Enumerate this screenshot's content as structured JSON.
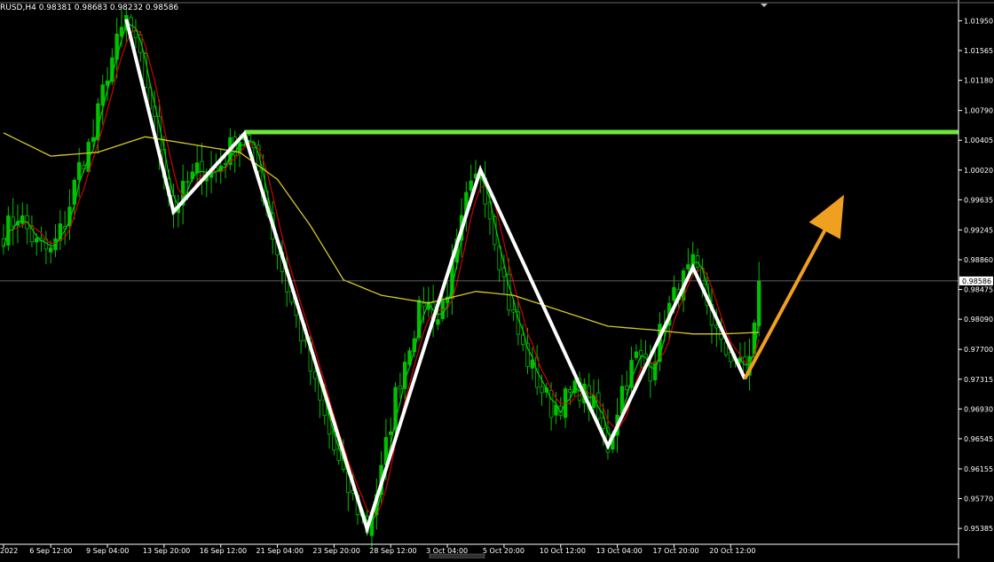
{
  "header": {
    "symbol_info": "RUSD,H4  0.98381 0.98683 0.98232 0.98586"
  },
  "colors": {
    "background": "#000000",
    "frame": "#ffffff",
    "bull_candle": "#00c000",
    "bear_candle": "#000000",
    "wick": "#00c000",
    "ma_fast": "#d40000",
    "ma_mid": "#00d000",
    "ma_slow": "#d8c828",
    "resistance": "#6ee63c",
    "pattern_lines": "#ffffff",
    "forecast_arrow": "#f0a020",
    "bid_line": "#808080",
    "current_price_tag_bg": "#ffffff",
    "current_price_tag_text": "#000000"
  },
  "chart_data": {
    "type": "candlestick",
    "ylim": [
      0.9518,
      1.0215
    ],
    "price_axis_ticks": [
      "1.01950",
      "1.01565",
      "1.01180",
      "1.00790",
      "1.00405",
      "1.00020",
      "0.99635",
      "0.99245",
      "0.98860",
      "0.98475",
      "0.98090",
      "0.97700",
      "0.97315",
      "0.96930",
      "0.96545",
      "0.96155",
      "0.95770",
      "0.95385"
    ],
    "time_axis_ticks": [
      {
        "label": "2022",
        "i": 0
      },
      {
        "label": "6 Sep 12:00",
        "i": 10
      },
      {
        "label": "9 Sep 04:00",
        "i": 22
      },
      {
        "label": "13 Sep 20:00",
        "i": 34
      },
      {
        "label": "16 Sep 12:00",
        "i": 46
      },
      {
        "label": "21 Sep 04:00",
        "i": 58
      },
      {
        "label": "23 Sep 20:00",
        "i": 70
      },
      {
        "label": "28 Sep 12:00",
        "i": 82
      },
      {
        "label": "3 Oct 04:00",
        "i": 94
      },
      {
        "label": "5 Oct 20:00",
        "i": 106
      },
      {
        "label": "10 Oct 12:00",
        "i": 118
      },
      {
        "label": "13 Oct 04:00",
        "i": 130
      },
      {
        "label": "17 Oct 20:00",
        "i": 142
      },
      {
        "label": "20 Oct 12:00",
        "i": 154
      }
    ],
    "bar_count": 161,
    "current_price": 0.98586,
    "current_price_label": "0.98586",
    "resistance_level": 1.0051,
    "zigzag_points": [
      {
        "i": 26,
        "price": 1.0197
      },
      {
        "i": 36,
        "price": 0.9948
      },
      {
        "i": 51,
        "price": 1.0049
      },
      {
        "i": 77,
        "price": 0.9538
      },
      {
        "i": 101,
        "price": 1.0002
      },
      {
        "i": 128,
        "price": 0.9645
      },
      {
        "i": 146,
        "price": 0.9876
      },
      {
        "i": 157,
        "price": 0.9732
      }
    ],
    "forecast_arrow": {
      "from": {
        "i": 157,
        "price": 0.9732
      },
      "to": {
        "i": 178,
        "price": 0.997
      }
    },
    "price_anchors": [
      [
        0,
        0.992
      ],
      [
        3,
        0.9945
      ],
      [
        7,
        0.9905
      ],
      [
        10,
        0.9895
      ],
      [
        13,
        0.9935
      ],
      [
        16,
        1.0005
      ],
      [
        19,
        1.0045
      ],
      [
        22,
        1.013
      ],
      [
        26,
        1.0197
      ],
      [
        29,
        1.014
      ],
      [
        32,
        1.006
      ],
      [
        36,
        0.9948
      ],
      [
        39,
        0.9985
      ],
      [
        42,
        1.0005
      ],
      [
        45,
        1.0
      ],
      [
        48,
        1.003
      ],
      [
        51,
        1.0049
      ],
      [
        54,
        1.0
      ],
      [
        57,
        0.992
      ],
      [
        60,
        0.985
      ],
      [
        63,
        0.979
      ],
      [
        66,
        0.972
      ],
      [
        69,
        0.966
      ],
      [
        72,
        0.96
      ],
      [
        75,
        0.9565
      ],
      [
        77,
        0.9538
      ],
      [
        80,
        0.961
      ],
      [
        83,
        0.971
      ],
      [
        86,
        0.978
      ],
      [
        89,
        0.9835
      ],
      [
        92,
        0.981
      ],
      [
        95,
        0.987
      ],
      [
        98,
        0.996
      ],
      [
        101,
        1.0002
      ],
      [
        104,
        0.992
      ],
      [
        107,
        0.983
      ],
      [
        110,
        0.977
      ],
      [
        113,
        0.973
      ],
      [
        116,
        0.9695
      ],
      [
        119,
        0.9705
      ],
      [
        122,
        0.972
      ],
      [
        125,
        0.9695
      ],
      [
        128,
        0.9645
      ],
      [
        131,
        0.972
      ],
      [
        134,
        0.976
      ],
      [
        137,
        0.9745
      ],
      [
        140,
        0.981
      ],
      [
        143,
        0.985
      ],
      [
        146,
        0.9876
      ],
      [
        149,
        0.983
      ],
      [
        152,
        0.977
      ],
      [
        155,
        0.976
      ],
      [
        157,
        0.9732
      ],
      [
        159,
        0.98
      ],
      [
        160,
        0.9858
      ]
    ],
    "ma_slow_anchors": [
      [
        0,
        1.005
      ],
      [
        10,
        1.002
      ],
      [
        20,
        1.0025
      ],
      [
        30,
        1.0045
      ],
      [
        40,
        1.0035
      ],
      [
        50,
        1.0025
      ],
      [
        58,
        0.999
      ],
      [
        65,
        0.993
      ],
      [
        72,
        0.986
      ],
      [
        80,
        0.984
      ],
      [
        90,
        0.983
      ],
      [
        100,
        0.9845
      ],
      [
        108,
        0.984
      ],
      [
        118,
        0.982
      ],
      [
        128,
        0.98
      ],
      [
        138,
        0.9795
      ],
      [
        146,
        0.979
      ],
      [
        152,
        0.979
      ],
      [
        160,
        0.9792
      ]
    ]
  }
}
